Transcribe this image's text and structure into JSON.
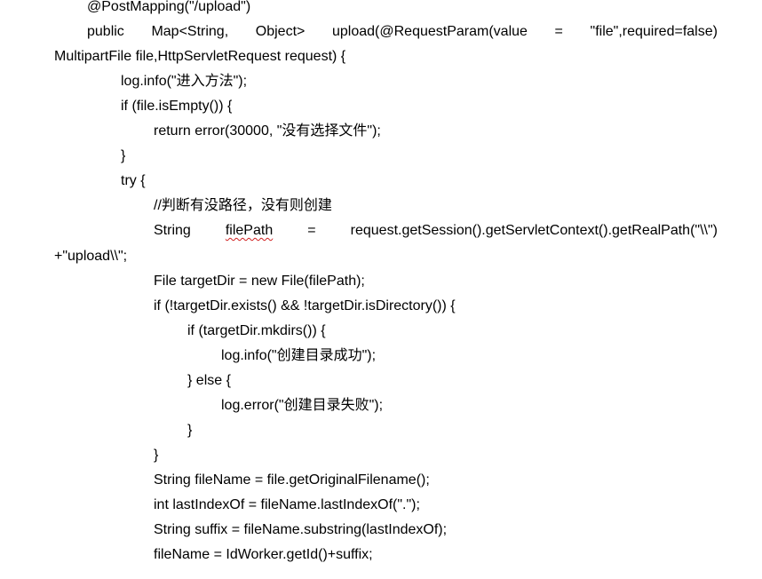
{
  "document": {
    "lines": [
      "@PostMapping(\"/upload\")",
      [
        "public",
        "Map<String,",
        "Object>",
        "upload(@RequestParam(value",
        "=",
        "\"file\",required=false)"
      ],
      "MultipartFile file,HttpServletRequest request) {",
      "log.info(\"进入方法\");",
      "if (file.isEmpty()) {",
      "return error(30000, \"没有选择文件\");",
      "}",
      "try {",
      "//判断有没路径，没有则创建",
      [
        "String",
        "filePath",
        "=",
        "request.getSession().getServletContext().getRealPath(\"\\\\\")"
      ],
      "+\"upload\\\\\";",
      "File targetDir = new File(filePath);",
      "if (!targetDir.exists() && !targetDir.isDirectory()) {",
      "if (targetDir.mkdirs()) {",
      "log.info(\"创建目录成功\");",
      "} else {",
      "log.error(\"创建目录失败\");",
      "}",
      "}",
      "String fileName = file.getOriginalFilename();",
      "int lastIndexOf = fileName.lastIndexOf(\".\");",
      "String suffix = fileName.substring(lastIndexOf);",
      "fileName = IdWorker.getId()+suffix;"
    ]
  }
}
